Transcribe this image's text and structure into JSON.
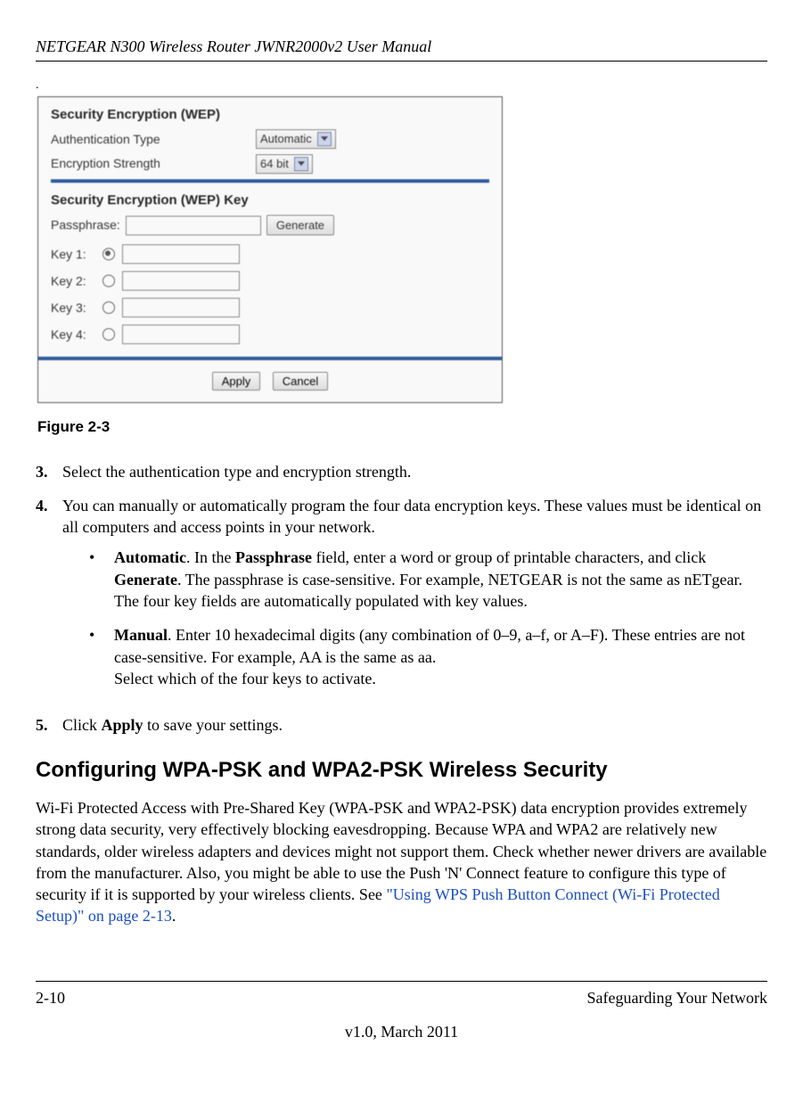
{
  "header": {
    "title": "NETGEAR N300 Wireless Router JWNR2000v2 User Manual"
  },
  "figure": {
    "wep": {
      "section1_title": "Security Encryption (WEP)",
      "auth_label": "Authentication Type",
      "auth_value": "Automatic",
      "enc_label": "Encryption Strength",
      "enc_value": "64 bit",
      "section2_title": "Security Encryption (WEP) Key",
      "passphrase_label": "Passphrase:",
      "generate_btn": "Generate",
      "keys": [
        {
          "label": "Key 1:",
          "selected": true
        },
        {
          "label": "Key 2:",
          "selected": false
        },
        {
          "label": "Key 3:",
          "selected": false
        },
        {
          "label": "Key 4:",
          "selected": false
        }
      ],
      "apply_btn": "Apply",
      "cancel_btn": "Cancel"
    },
    "caption": "Figure 2-3"
  },
  "steps": {
    "s3": {
      "num": "3.",
      "text": "Select the authentication type and encryption strength."
    },
    "s4": {
      "num": "4.",
      "text": "You can manually or automatically program the four data encryption keys. These values must be identical on all computers and access points in your network.",
      "auto_label": "Automatic",
      "auto_text_a": ". In the ",
      "passphrase_bold": "Passphrase",
      "auto_text_b": " field, enter a word or group of printable characters, and click ",
      "generate_bold": "Generate",
      "auto_text_c": ". The passphrase is case-sensitive. For example, NETGEAR is not the same as nETgear. The four key fields are automatically populated with key values.",
      "manual_label": "Manual",
      "manual_text": ". Enter 10 hexadecimal digits (any combination of 0–9, a–f, or A–F). These entries are not case-sensitive. For example, AA is the same as aa.",
      "manual_text2": "Select which of the four keys to activate."
    },
    "s5": {
      "num": "5.",
      "text_a": "Click ",
      "apply_bold": "Apply",
      "text_b": " to save your settings."
    }
  },
  "section": {
    "heading": "Configuring WPA-PSK and WPA2-PSK Wireless Security",
    "para_a": "Wi-Fi Protected Access with Pre-Shared Key (WPA-PSK and WPA2-PSK) data encryption provides extremely strong data security, very effectively blocking eavesdropping. Because WPA and WPA2 are relatively new standards, older wireless adapters and devices might not support them. Check whether newer drivers are available from the manufacturer. Also, you might be able to use the Push 'N' Connect feature to configure this type of security if it is supported by your wireless clients. See ",
    "link_text": "\"Using WPS Push Button Connect (Wi-Fi Protected Setup)\" on page 2-13",
    "para_b": "."
  },
  "footer": {
    "page": "2-10",
    "right": "Safeguarding Your Network",
    "version": "v1.0, March 2011"
  }
}
